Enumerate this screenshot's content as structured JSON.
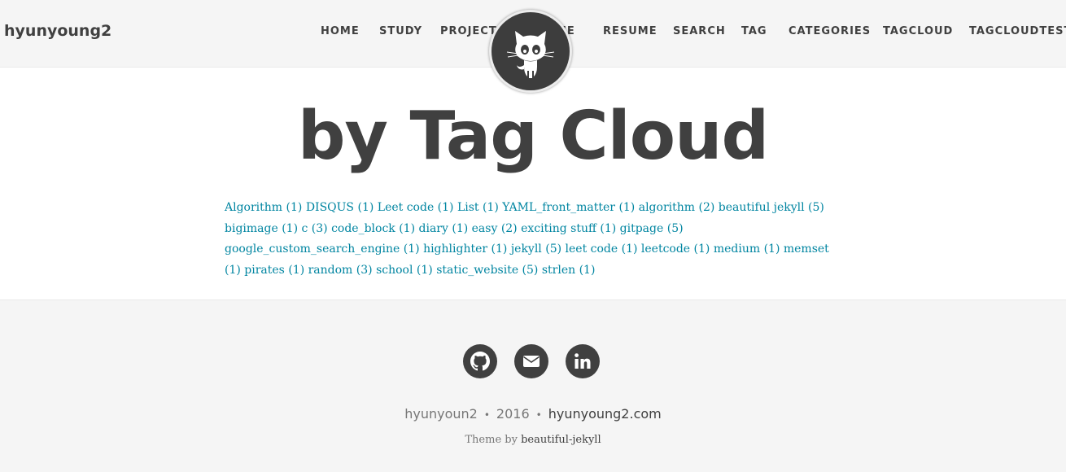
{
  "brand": "hyunyoung2",
  "nav": [
    "HOME",
    "STUDY",
    "PROJECTS",
    "ME",
    "RESUME",
    "SEARCH",
    "TAG",
    "CATEGORIES",
    "TAGCLOUD",
    "TAGCLOUDTEST"
  ],
  "page_title": "by Tag Cloud",
  "tags": [
    "Algorithm (1)",
    "DISQUS (1)",
    "Leet code (1)",
    "List (1)",
    "YAML_front_matter (1)",
    "algorithm (2)",
    "beautiful jekyll (5)",
    "bigimage (1)",
    "c (3)",
    "code_block (1)",
    "diary (1)",
    "easy (2)",
    "exciting stuff (1)",
    "gitpage (5)",
    "google_custom_search_engine (1)",
    "highlighter (1)",
    "jekyll (5)",
    "leet code (1)",
    "leetcode (1)",
    "medium (1)",
    "memset (1)",
    "pirates (1)",
    "random (3)",
    "school (1)",
    "static_website (5)",
    "strlen (1)"
  ],
  "footer": {
    "social": [
      "github-icon",
      "envelope-icon",
      "linkedin-icon"
    ],
    "author": "hyunyoun2",
    "separator": "•",
    "year": "2016",
    "site": "hyunyoung2.com",
    "theme_prefix": "Theme by",
    "theme_name": "beautiful-jekyll"
  }
}
